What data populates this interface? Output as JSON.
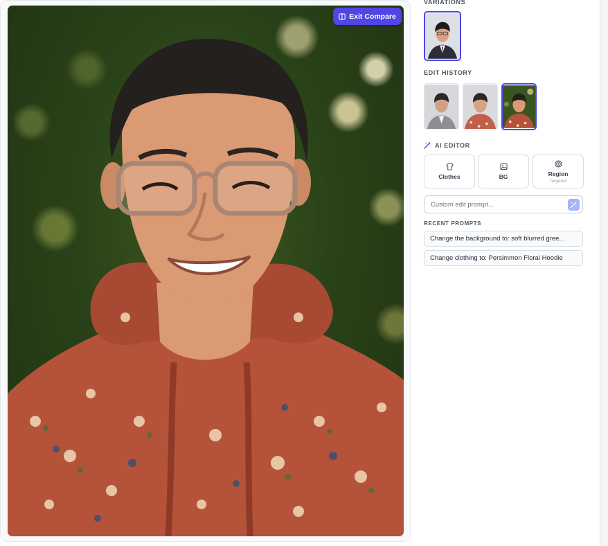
{
  "compare": {
    "exit_label": "Exit Compare"
  },
  "sections": {
    "variations": "VARIATIONS",
    "edit_history": "EDIT HISTORY",
    "ai_editor": "AI EDITOR",
    "recent_prompts": "RECENT PROMPTS"
  },
  "ai_editor": {
    "tools": [
      {
        "label": "Clothes",
        "icon": "shirt-icon"
      },
      {
        "label": "BG",
        "icon": "image-icon"
      },
      {
        "label": "Region",
        "sublabel": "Targeted",
        "icon": "target-icon"
      }
    ],
    "prompt_placeholder": "Custom edit prompt..."
  },
  "recent_prompts": [
    "Change the background to: soft blurred gree...",
    "Change clothing to: Persimmon Floral Hoodie"
  ],
  "colors": {
    "accent": "#4f46e5",
    "accent_light": "#a5b4fc",
    "hoodie": "#b4533a",
    "suit": "#2b2e3a"
  }
}
